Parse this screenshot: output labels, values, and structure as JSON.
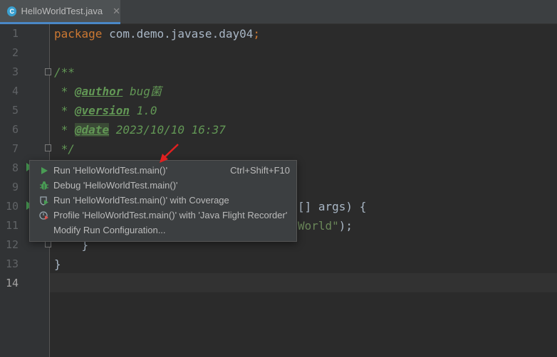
{
  "tab": {
    "filename": "HelloWorldTest.java",
    "icon_letter": "C",
    "close_glyph": "✕"
  },
  "gutter": {
    "line_numbers": [
      "1",
      "2",
      "3",
      "4",
      "5",
      "6",
      "7",
      "8",
      "9",
      "10",
      "11",
      "12",
      "13",
      "14"
    ]
  },
  "code": {
    "l1_kw": "package",
    "l1_rest": " com.demo.javase.day04",
    "l1_semi": ";",
    "l3": "/**",
    "l4_prefix": " * ",
    "l4_tag": "@author",
    "l4_val": " bug菌",
    "l5_prefix": " * ",
    "l5_tag": "@version",
    "l5_val": " 1.0",
    "l6_prefix": " * ",
    "l6_tag": "@date",
    "l6_val": " 2023/10/10 16:37",
    "l7": " */",
    "l10_tail": "[] args) {",
    "l11_str": "World\"",
    "l11_end": ");",
    "l12": "    }",
    "l13": "}"
  },
  "context_menu": {
    "items": [
      {
        "label": "Run 'HelloWorldTest.main()'",
        "shortcut": "Ctrl+Shift+F10",
        "icon": "run-icon"
      },
      {
        "label": "Debug 'HelloWorldTest.main()'",
        "icon": "debug-icon"
      },
      {
        "label": "Run 'HelloWorldTest.main()' with Coverage",
        "icon": "coverage-icon"
      },
      {
        "label": "Profile 'HelloWorldTest.main()' with 'Java Flight Recorder'",
        "icon": "profile-icon"
      },
      {
        "label": "Modify Run Configuration...",
        "icon": ""
      }
    ]
  },
  "colors": {
    "accent": "#4a88c7",
    "run_green": "#499c54",
    "annotation_red": "#e02020"
  }
}
